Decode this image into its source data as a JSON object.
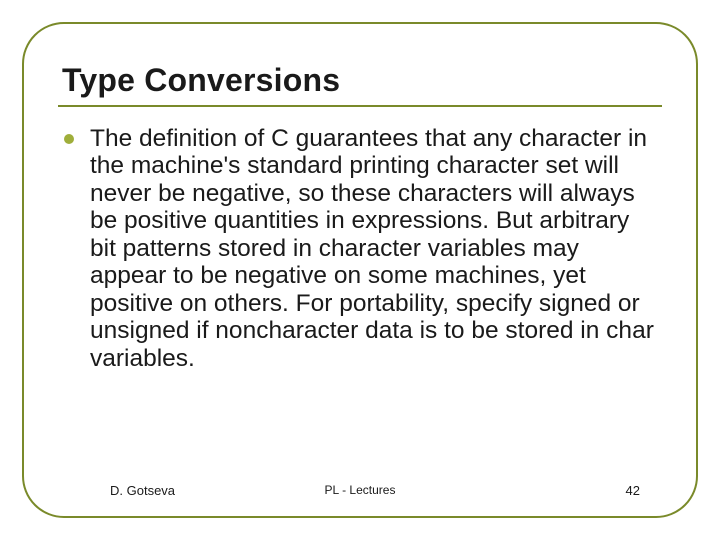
{
  "slide": {
    "title": "Type Conversions",
    "bullet_text": "The definition of C guarantees that any character in the machine's standard printing character set will never be negative, so these characters will always be positive quantities in expressions. But arbitrary bit patterns stored in character variables may appear to be negative on some machines, yet positive on others. For portability, specify signed or unsigned if noncharacter data is to be stored in char variables."
  },
  "footer": {
    "author": "D. Gotseva",
    "center": "PL - Lectures",
    "page": "42"
  },
  "colors": {
    "accent": "#7a8a2a",
    "bullet": "#9fae3a"
  }
}
